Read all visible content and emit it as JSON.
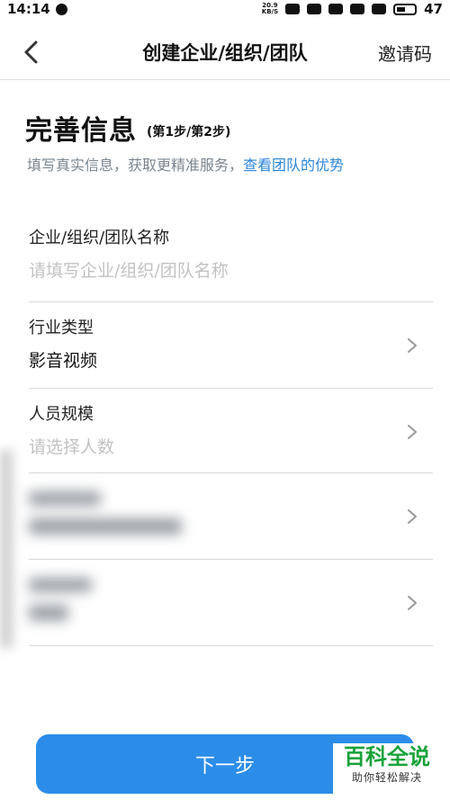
{
  "status_bar": {
    "time": "14:14",
    "net_speed_top": "20.9",
    "net_speed_bottom": "KB/S",
    "battery": "47"
  },
  "header": {
    "title": "创建企业/组织/团队",
    "invite_label": "邀请码"
  },
  "intro": {
    "title": "完善信息",
    "step": "(第1步/第2步)",
    "description": "填写真实信息，获取更精准服务，",
    "link": "查看团队的优势"
  },
  "form": {
    "name": {
      "label": "企业/组织/团队名称",
      "placeholder": "请填写企业/组织/团队名称"
    },
    "industry": {
      "label": "行业类型",
      "value": "影音视频"
    },
    "size": {
      "label": "人员规模",
      "placeholder": "请选择人数"
    }
  },
  "next_button": "下一步",
  "watermark": {
    "title": "百科全说",
    "subtitle": "助你轻松解决"
  }
}
